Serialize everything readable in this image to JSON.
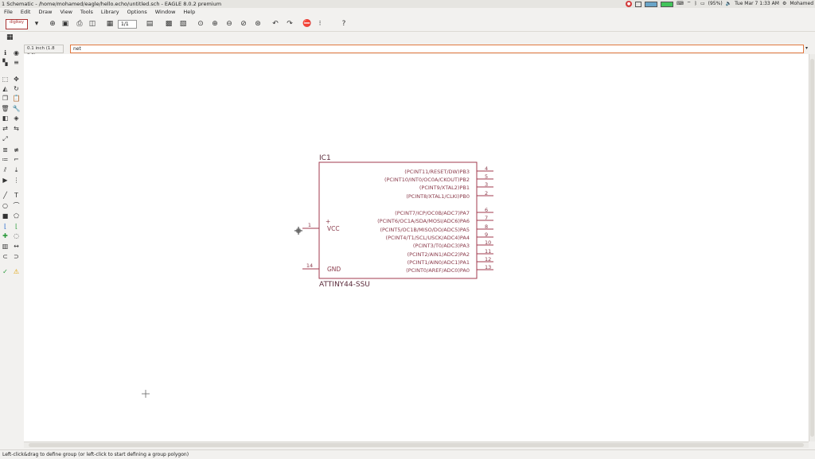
{
  "window": {
    "title": "1 Schematic - /home/mohamed/eagle/hello.echo/untitled.sch - EAGLE 8.0.2 premium",
    "clock": "Tue Mar 7 1:33 AM",
    "user": "Mohamed",
    "battery": "(95%)"
  },
  "menu": [
    "File",
    "Edit",
    "Draw",
    "View",
    "Tools",
    "Library",
    "Options",
    "Window",
    "Help"
  ],
  "toolbar": {
    "logo": "digikey",
    "page": "1/1"
  },
  "command": {
    "grid_info": "0.1 inch (1.8 2.0)",
    "value": "net"
  },
  "part": {
    "name": "IC1",
    "value": "ATTINY44-SSU",
    "left_pins": [
      {
        "num": "1",
        "signal": "VCC"
      },
      {
        "num": "14",
        "signal": "GND"
      }
    ],
    "right_pins": [
      {
        "num": "4",
        "signal": "(PCINT11/RESET/DW)PB3"
      },
      {
        "num": "5",
        "signal": "(PCINT10/INT0/OC0A/CKOUT)PB2"
      },
      {
        "num": "3",
        "signal": "(PCINT9/XTAL2)PB1"
      },
      {
        "num": "2",
        "signal": "(PCINT8/XTAL1/CLKI)PB0"
      },
      {
        "num": "6",
        "signal": "(PCINT7/ICP/OC0B/ADC7)PA7"
      },
      {
        "num": "7",
        "signal": "(PCINT6/OC1A/SDA/MOSI/ADC6)PA6"
      },
      {
        "num": "8",
        "signal": "(PCINT5/OC1B/MISO/DO/ADC5)PA5"
      },
      {
        "num": "9",
        "signal": "(PCINT4/T1/SCL/USCK/ADC4)PA4"
      },
      {
        "num": "10",
        "signal": "(PCINT3/T0/ADC3)PA3"
      },
      {
        "num": "11",
        "signal": "(PCINT2/AIN1/ADC2)PA2"
      },
      {
        "num": "12",
        "signal": "(PCINT1/AIN0/ADC1)PA1"
      },
      {
        "num": "13",
        "signal": "(PCINT0/AREF/ADC0)PA0"
      }
    ],
    "origin_mark": "+"
  },
  "status": "Left-click&drag to define group (or left-click to start defining a group polygon)",
  "colors": {
    "part_outline": "#a0384c",
    "command_border": "#e07840"
  }
}
